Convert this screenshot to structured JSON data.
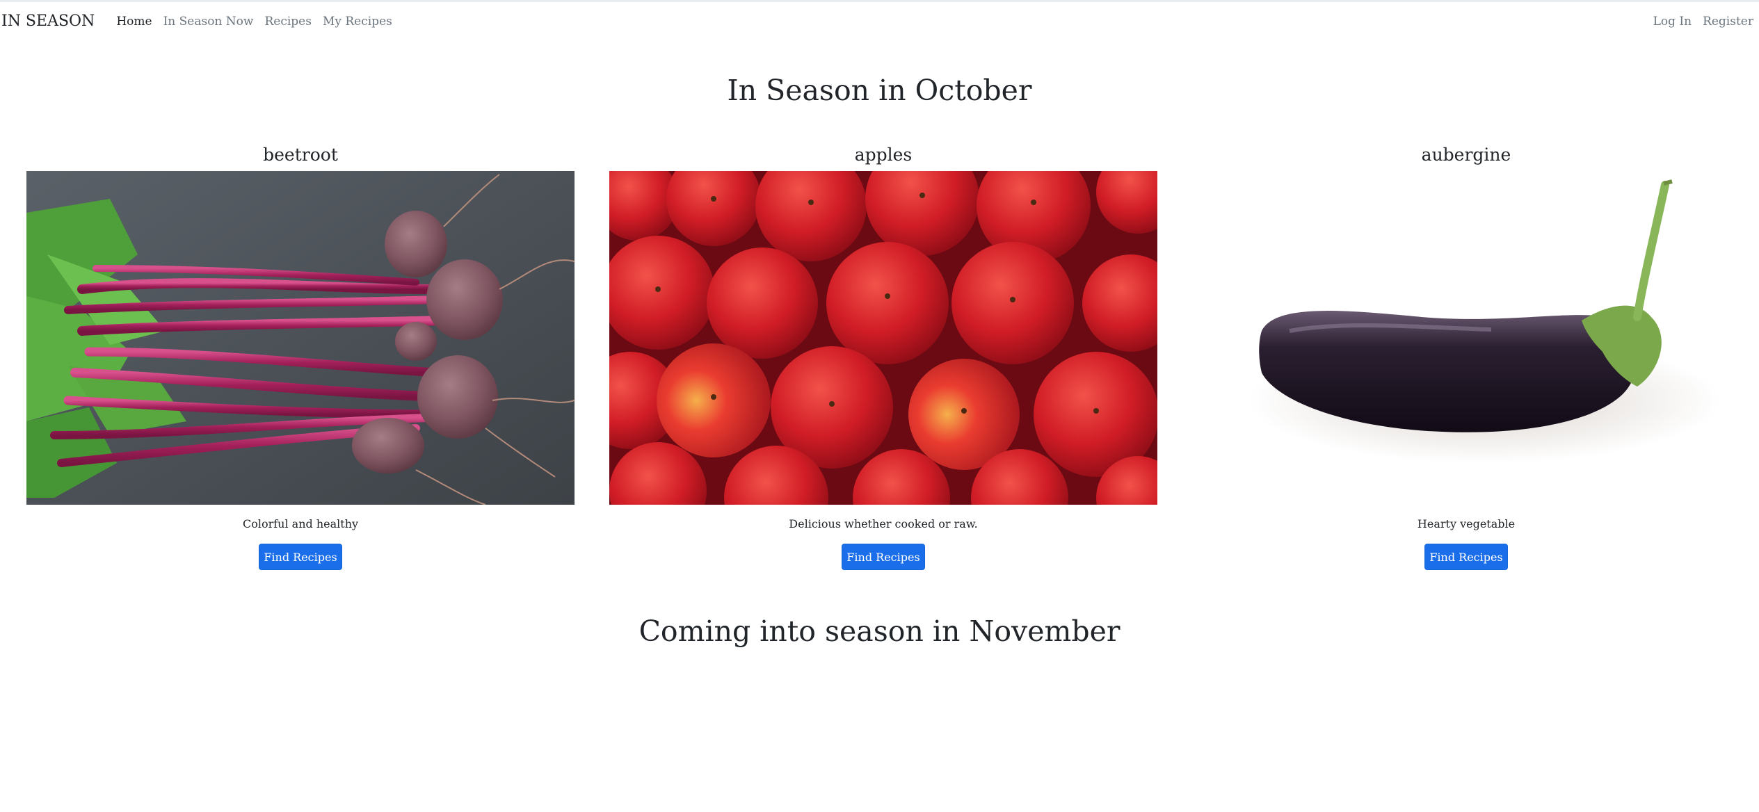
{
  "nav": {
    "brand": "IN SEASON",
    "links": [
      "Home",
      "In Season Now",
      "Recipes",
      "My Recipes"
    ],
    "right": [
      "Log In",
      "Register"
    ]
  },
  "main": {
    "heading": "In Season in October",
    "cards": [
      {
        "title": "beetroot",
        "description": "Colorful and healthy",
        "button": "Find Recipes"
      },
      {
        "title": "apples",
        "description": "Delicious whether cooked or raw.",
        "button": "Find Recipes"
      },
      {
        "title": "aubergine",
        "description": "Hearty vegetable",
        "button": "Find Recipes"
      }
    ],
    "next_heading": "Coming into season in November"
  },
  "colors": {
    "primary_button": "#1a6ee9",
    "text": "#212529",
    "muted_nav": "#6c757d"
  }
}
